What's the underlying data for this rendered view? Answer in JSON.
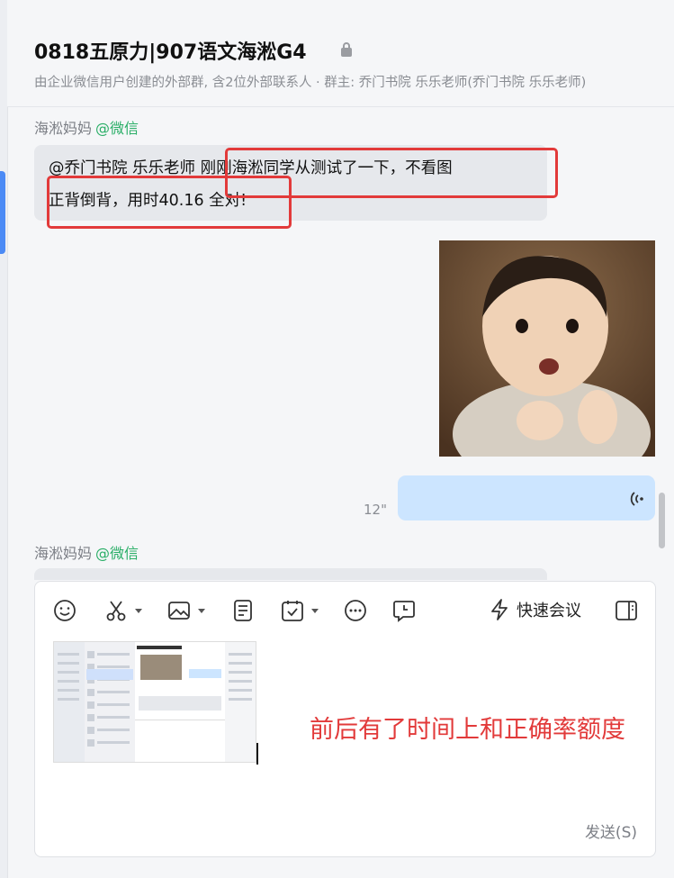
{
  "header": {
    "title": "0818五原力|907语文海淞G4",
    "subtitle": "由企业微信用户创建的外部群, 含2位外部联系人 · 群主: 乔门书院 乐乐老师(乔门书院 乐乐老师)"
  },
  "messages": [
    {
      "sender": "海淞妈妈",
      "app": "@微信",
      "line1": "@乔门书院 乐乐老师  刚刚海淞同学从测试了一下，不看图",
      "line2": "正背倒背，用时40.16 全对!"
    },
    {
      "type": "image",
      "icon": "baby-photo-icon"
    },
    {
      "type": "voice",
      "duration": "12\"",
      "icon": "voice-wave-icon"
    },
    {
      "sender": "海淞妈妈",
      "app": "@微信"
    }
  ],
  "toolbar": {
    "quick_meeting": "快速会议"
  },
  "compose": {
    "annotation": "前后有了时间上和正确率额度",
    "send_label": "发送(S)"
  },
  "colors": {
    "accent": "#4b8af5",
    "wechat_green": "#2aae67",
    "voice_bubble": "#cce5ff",
    "annotation_red": "#e23a3a"
  }
}
